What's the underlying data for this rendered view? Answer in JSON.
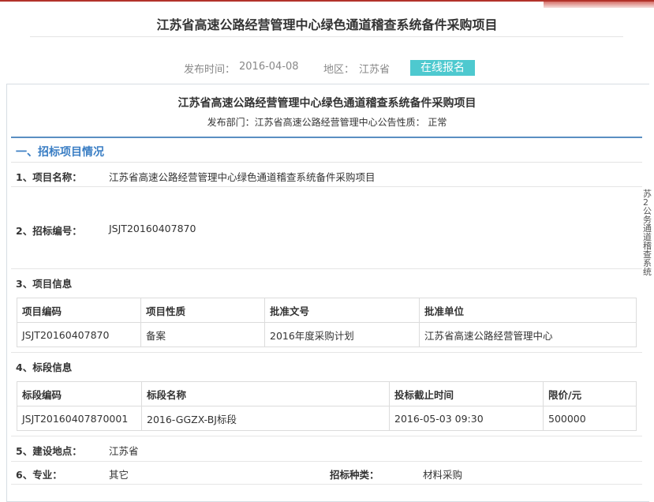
{
  "page": {
    "title": "江苏省高速公路经营管理中心绿色通道稽查系统备件采购项目",
    "publish_time_label": "发布时间：",
    "publish_time": "2016-04-08",
    "region_label": "地区：",
    "region": "江苏省",
    "signup_button": "在线报名"
  },
  "detail": {
    "title": "江苏省高速公路经营管理中心绿色通道稽查系统备件采购项目",
    "dept_line": "发布部门：江苏省高速公路经营管理中心公告性质：  正常",
    "side_text": "苏2公务通道稽查系统"
  },
  "section1": {
    "heading": "一、招标项目情况",
    "project_name_label": "1、项目名称：",
    "project_name": "江苏省高速公路经营管理中心绿色通道稽查系统备件采购项目",
    "bid_no_label": "2、招标编号：",
    "bid_no": "JSJT20160407870",
    "project_info_label": "3、项目信息",
    "project_table": {
      "headers": [
        "项目编码",
        "项目性质",
        "批准文号",
        "批准单位"
      ],
      "row": [
        "JSJT20160407870",
        "备案",
        "2016年度采购计划",
        "江苏省高速公路经营管理中心"
      ]
    },
    "section_info_label": "4、标段信息",
    "section_table": {
      "headers": [
        "标段编码",
        "标段名称",
        "投标截止时间",
        "限价/元"
      ],
      "row": [
        "JSJT20160407870001",
        "2016-GGZX-BJ标段",
        "2016-05-03 09:30",
        "500000"
      ]
    },
    "location_label": "5、建设地点：",
    "location": "江苏省",
    "major_label": "6、专业：",
    "major": "其它",
    "bid_type_label": "招标种类：",
    "bid_type": "材料采购"
  }
}
